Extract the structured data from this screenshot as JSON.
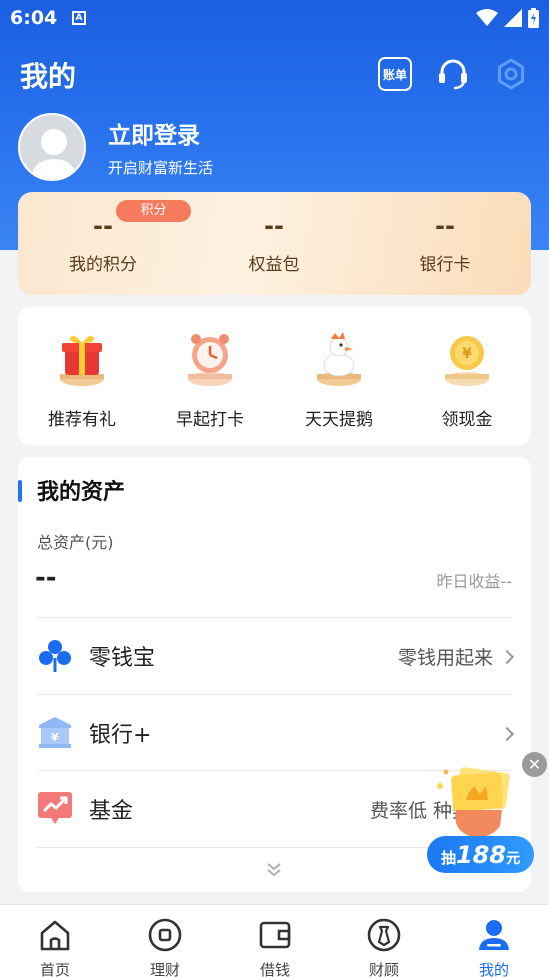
{
  "status_bar": {
    "time": "6:04",
    "notif_letter": "A"
  },
  "header": {
    "title": "我的",
    "bill_label": "账单"
  },
  "profile": {
    "login_title": "立即登录",
    "login_subtitle": "开启财富新生活"
  },
  "points": {
    "badge": "积分",
    "items": [
      {
        "value": "--",
        "label": "我的积分"
      },
      {
        "value": "--",
        "label": "权益包"
      },
      {
        "value": "--",
        "label": "银行卡"
      }
    ]
  },
  "activities": [
    {
      "label": "推荐有礼",
      "icon": "gift-icon"
    },
    {
      "label": "早起打卡",
      "icon": "alarm-clock-icon"
    },
    {
      "label": "天天提鹅",
      "icon": "goose-icon"
    },
    {
      "label": "领现金",
      "icon": "gold-coin-icon"
    }
  ],
  "assets": {
    "title": "我的资产",
    "total_label": "总资产(元)",
    "total_value": "--",
    "yesterday": "昨日收益--",
    "rows": [
      {
        "label": "零钱宝",
        "right": "零钱用起来",
        "icon": "clover-icon"
      },
      {
        "label": "银行+",
        "right": "",
        "icon": "bank-icon"
      },
      {
        "label": "基金",
        "right": "费率低 种类",
        "icon": "trend-chart-icon"
      }
    ]
  },
  "promo": {
    "prefix": "抽",
    "amount": "188",
    "unit": "元"
  },
  "tabbar": [
    {
      "label": "首页",
      "icon": "home-icon"
    },
    {
      "label": "理财",
      "icon": "wealth-icon"
    },
    {
      "label": "借钱",
      "icon": "wallet-icon"
    },
    {
      "label": "财顾",
      "icon": "advisor-icon"
    },
    {
      "label": "我的",
      "icon": "profile-icon",
      "active": true
    }
  ],
  "colors": {
    "primary": "#1a6df0",
    "header_blue": "#2a73ee",
    "points_text": "#5a3b1c",
    "badge": "#f67a5c"
  }
}
